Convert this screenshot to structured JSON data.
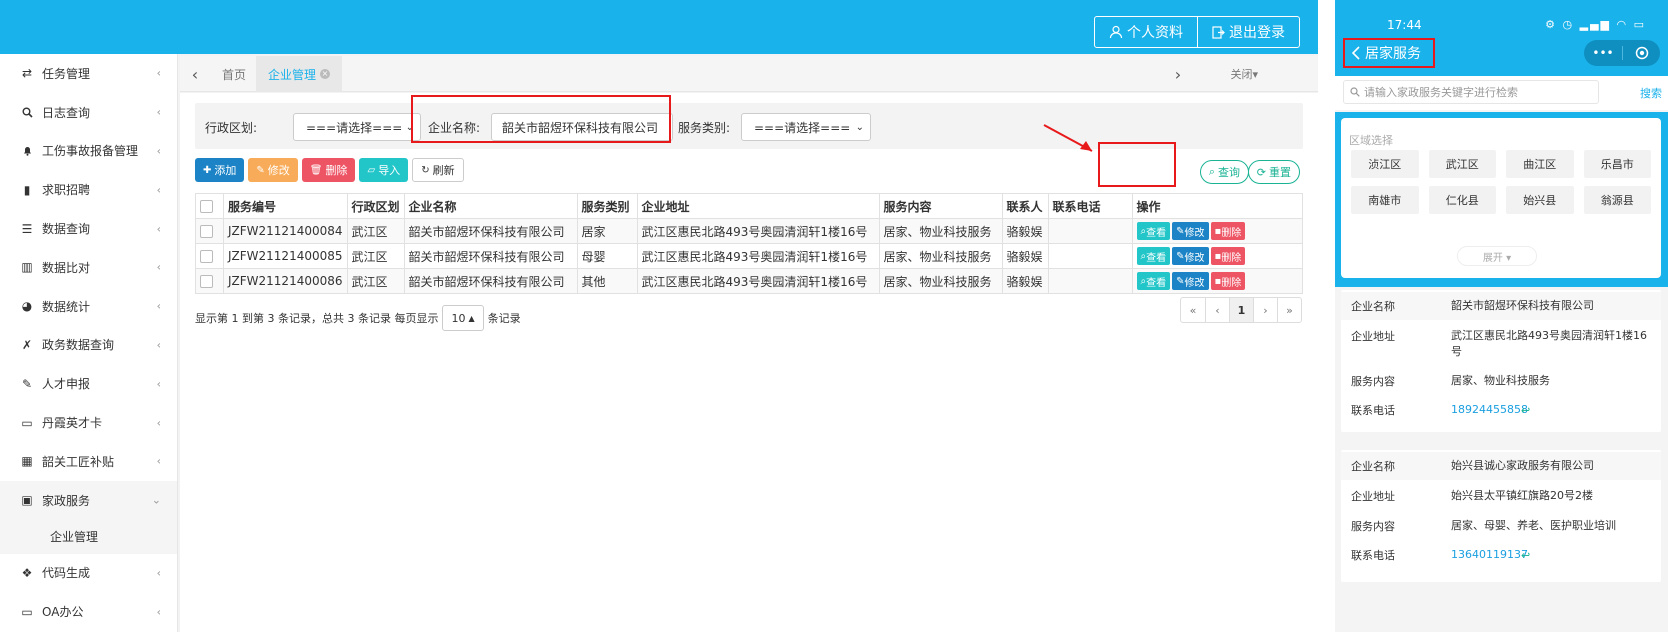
{
  "topbar": {
    "profile_label": "个人资料",
    "logout_label": "退出登录"
  },
  "sidebar": {
    "items": [
      {
        "icon": "exchange-icon",
        "glyph": "⇄",
        "label": "任务管理"
      },
      {
        "icon": "search-icon",
        "glyph": "🔍︎",
        "label": "日志查询"
      },
      {
        "icon": "bell-icon",
        "glyph": "🔔︎",
        "label": "工伤事故报备管理"
      },
      {
        "icon": "briefcase-icon",
        "glyph": "▮",
        "label": "求职招聘"
      },
      {
        "icon": "list-icon",
        "glyph": "☰",
        "label": "数据查询"
      },
      {
        "icon": "bar-chart-icon",
        "glyph": "▥",
        "label": "数据比对"
      },
      {
        "icon": "pie-chart-icon",
        "glyph": "◕",
        "label": "数据统计"
      },
      {
        "icon": "pin-icon",
        "glyph": "✗",
        "label": "政务数据查询"
      },
      {
        "icon": "edit-icon",
        "glyph": "✎",
        "label": "人才申报"
      },
      {
        "icon": "card-icon",
        "glyph": "▭",
        "label": "丹霞英才卡"
      },
      {
        "icon": "grid-icon",
        "glyph": "▦",
        "label": "韶关工匠补贴"
      },
      {
        "icon": "home-service-icon",
        "glyph": "▣",
        "label": "家政服务"
      },
      {
        "icon": "cube-icon",
        "glyph": "❖",
        "label": "代码生成"
      },
      {
        "icon": "desktop-icon",
        "glyph": "▭",
        "label": "OA办公"
      }
    ],
    "sub_item": "企业管理"
  },
  "tabs": {
    "home": "首页",
    "active": "企业管理",
    "close_label": "关闭▾"
  },
  "filter": {
    "region_label": "行政区划:",
    "region_value": "===请选择===",
    "company_label": "企业名称:",
    "company_value": "韶关市韶煜环保科技有限公司",
    "service_label": "服务类别:",
    "service_value": "===请选择==="
  },
  "toolbar": {
    "add": "添加",
    "edit": "修改",
    "delete": "删除",
    "import": "导入",
    "refresh": "刷新",
    "search": "查询",
    "reset": "重置"
  },
  "table": {
    "headers": [
      "服务编号",
      "行政区划",
      "企业名称",
      "服务类别",
      "企业地址",
      "服务内容",
      "联系人",
      "联系电话",
      "操作"
    ],
    "rows": [
      {
        "id": "JZFW21121400084",
        "region": "武江区",
        "company": "韶关市韶煜环保科技有限公司",
        "category": "居家",
        "address": "武江区惠民北路493号奥园清润轩1楼16号",
        "content": "居家、物业科技服务",
        "contact": "骆毅娱",
        "phone": ""
      },
      {
        "id": "JZFW21121400085",
        "region": "武江区",
        "company": "韶关市韶煜环保科技有限公司",
        "category": "母婴",
        "address": "武江区惠民北路493号奥园清润轩1楼16号",
        "content": "居家、物业科技服务",
        "contact": "骆毅娱",
        "phone": ""
      },
      {
        "id": "JZFW21121400086",
        "region": "武江区",
        "company": "韶关市韶煜环保科技有限公司",
        "category": "其他",
        "address": "武江区惠民北路493号奥园清润轩1楼16号",
        "content": "居家、物业科技服务",
        "contact": "骆毅娱",
        "phone": ""
      }
    ],
    "ops": {
      "view": "查看",
      "edit": "修改",
      "delete": "删除"
    }
  },
  "pagination": {
    "info_prefix": "显示第 1 到第 3 条记录，总共 3 条记录 每页显示",
    "page_size": "10",
    "info_suffix": "条记录",
    "pages": [
      "«",
      "‹",
      "1",
      "›",
      "»"
    ],
    "current": "1"
  },
  "mobile": {
    "time": "17:44",
    "status_icons": "⚙ ◷ ▂▄▆ ◠ ▭",
    "title": "居家服务",
    "capsule_more": "•••",
    "search_placeholder": "请输入家政服务关键字进行检索",
    "search_btn": "搜索",
    "region_title": "区域选择",
    "regions": [
      "浈江区",
      "武江区",
      "曲江区",
      "乐昌市",
      "南雄市",
      "仁化县",
      "始兴县",
      "翁源县"
    ],
    "expand": "展开 ▾",
    "labels": {
      "company": "企业名称",
      "address": "企业地址",
      "content": "服务内容",
      "phone": "联系电话"
    },
    "cards": [
      {
        "company": "韶关市韶煜环保科技有限公司",
        "address": "武江区惠民北路493号奥园清润轩1楼16号",
        "content": "居家、物业科技服务",
        "phone": "18924455858"
      },
      {
        "company": "始兴县诚心家政服务有限公司",
        "address": "始兴县太平镇红旗路20号2楼",
        "content": "居家、母婴、养老、医护职业培训",
        "phone": "13640119137"
      }
    ]
  },
  "colors": {
    "brand": "#1ab2ea",
    "highlight": "#e8191b"
  }
}
